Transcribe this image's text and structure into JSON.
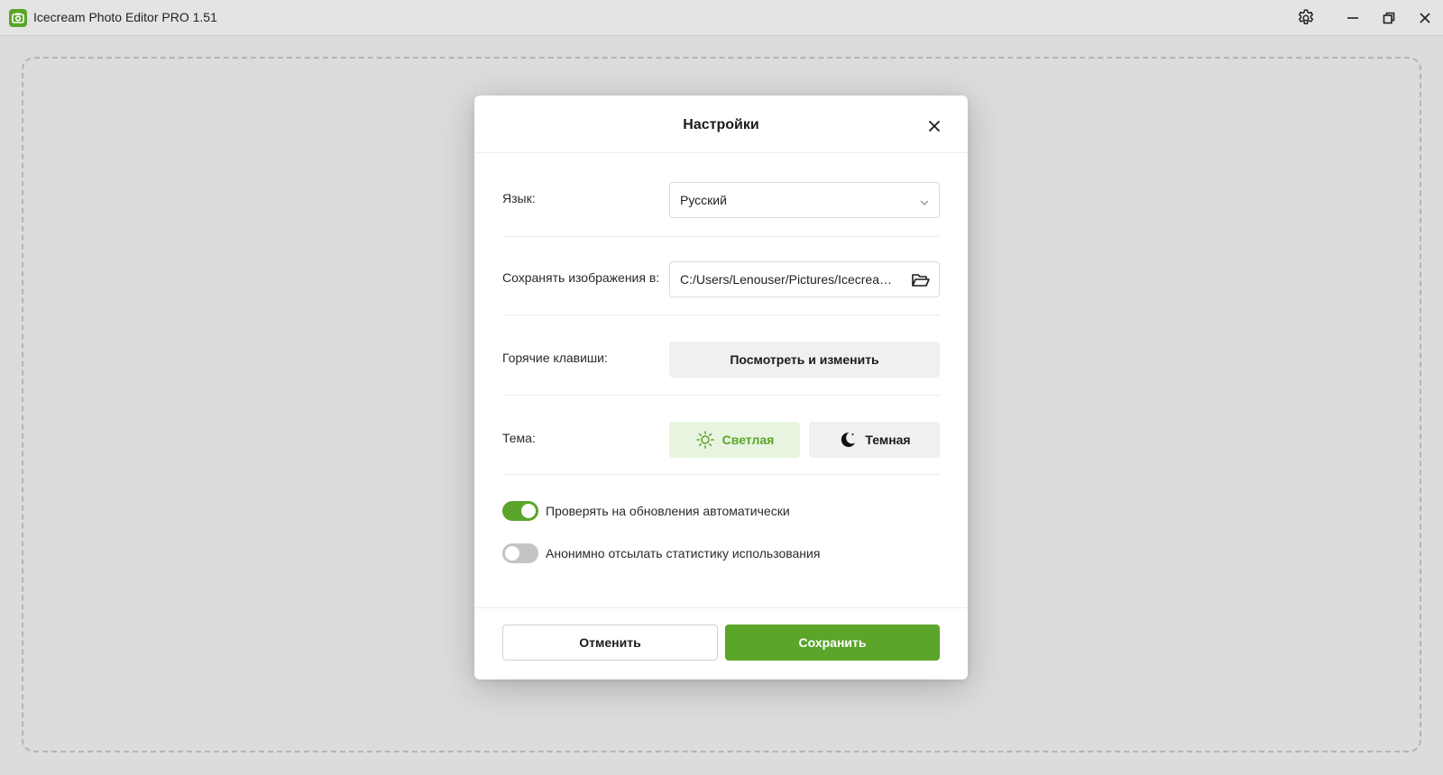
{
  "app": {
    "title": "Icecream Photo Editor PRO 1.51",
    "logo_icon": "camera-icon",
    "accent_color": "#5aa52a"
  },
  "titlebar": {
    "settings_icon": "gear-icon",
    "minimize_icon": "minimize-icon",
    "maximize_icon": "restore-icon",
    "close_icon": "close-icon"
  },
  "settings_dialog": {
    "title": "Настройки",
    "close_icon": "close-icon",
    "language": {
      "label": "Язык:",
      "value": "Русский",
      "icon": "chevron-down-icon"
    },
    "save_path": {
      "label": "Сохранять изображения в:",
      "value": "C:/Users/Lenouser/Pictures/Icecream ...",
      "icon": "folder-open-icon"
    },
    "hotkeys": {
      "label": "Горячие клавиши:",
      "button_label": "Посмотреть и изменить"
    },
    "theme": {
      "label": "Тема:",
      "light_label": "Светлая",
      "dark_label": "Темная",
      "selected": "light",
      "light_icon": "sun-icon",
      "dark_icon": "moon-icon"
    },
    "toggles": [
      {
        "label": "Проверять на обновления автоматически",
        "enabled": true
      },
      {
        "label": "Анонимно отсылать статистику использования",
        "enabled": false
      }
    ],
    "cancel_label": "Отменить",
    "save_label": "Сохранить"
  }
}
